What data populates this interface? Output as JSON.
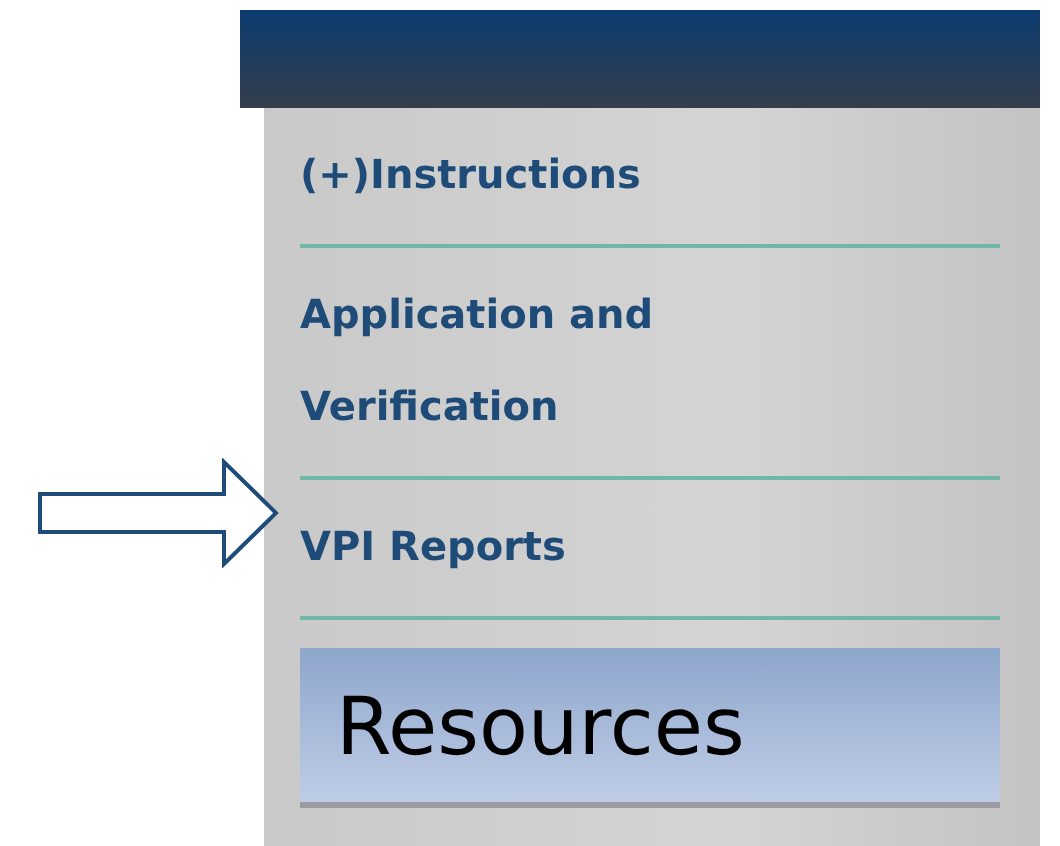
{
  "menu": {
    "items": [
      {
        "label": "(+)Instructions",
        "selected": false
      },
      {
        "label": "Application and Verification",
        "selected": false
      },
      {
        "label": "VPI Reports",
        "selected": false
      },
      {
        "label": "Resources",
        "selected": true
      }
    ]
  }
}
